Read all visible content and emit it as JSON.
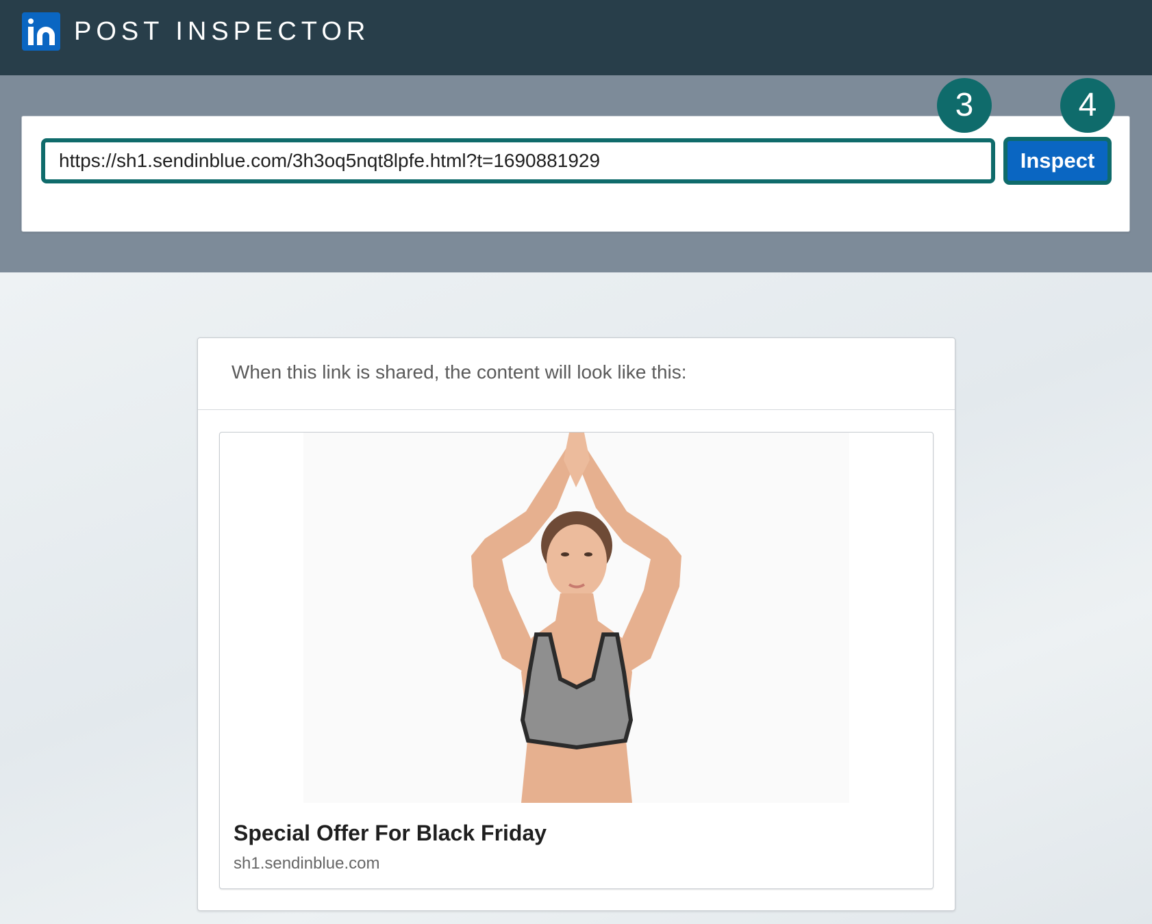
{
  "header": {
    "app_title": "POST INSPECTOR",
    "logo_icon": "linkedin-logo-icon",
    "background": "#283e4a",
    "logo_color": "#0a66c2"
  },
  "search": {
    "url_value": "https://sh1.sendinblue.com/3h3oq5nqt8lpfe.html?t=1690881929",
    "button_label": "Inspect",
    "accent_color": "#0f6b6b"
  },
  "annotations": {
    "step_input": "3",
    "step_button": "4"
  },
  "result": {
    "header_text": "When this link is shared, the content will look like this:",
    "preview": {
      "image_alt": "woman in gray sports bra with hands raised above head in yoga pose",
      "title": "Special Offer For Black Friday",
      "domain": "sh1.sendinblue.com"
    }
  }
}
